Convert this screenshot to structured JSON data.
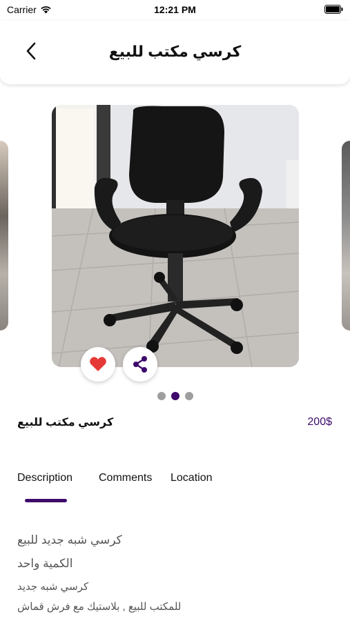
{
  "status_bar": {
    "carrier": "Carrier",
    "time": "12:21 PM"
  },
  "header": {
    "title": "كرسي مكتب للبيع",
    "back_icon": "chevron-left-icon"
  },
  "carousel": {
    "current_index": 2,
    "total": 3
  },
  "actions": {
    "favorite_icon": "heart-icon",
    "share_icon": "share-icon",
    "favorite_color": "#e53935",
    "share_color": "#3d0a6b"
  },
  "product": {
    "title": "كرسي مكتب للبيع",
    "price": "200$"
  },
  "tabs": [
    {
      "label": "Description",
      "active": true
    },
    {
      "label": "Comments",
      "active": false
    },
    {
      "label": "Location",
      "active": false
    }
  ],
  "description": [
    "كرسي شبه جديد للبيع",
    "الكمية واحد",
    "كرسي شبه جديد",
    "للمكتب للبيع , بلاستيك مع فرش قماش"
  ],
  "colors": {
    "accent": "#3d0a6b"
  }
}
